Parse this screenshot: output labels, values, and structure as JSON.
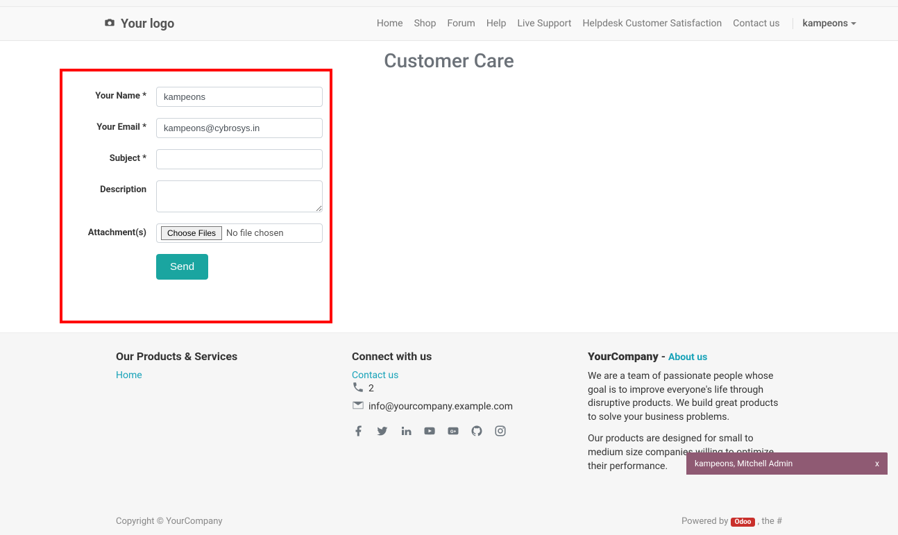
{
  "header": {
    "logo_text": "Your logo",
    "nav": [
      "Home",
      "Shop",
      "Forum",
      "Help",
      "Live Support",
      "Helpdesk Customer Satisfaction",
      "Contact us"
    ],
    "user": "kampeons"
  },
  "page": {
    "title": "Customer Care"
  },
  "form": {
    "name_label": "Your Name *",
    "name_value": "kampeons",
    "email_label": "Your Email *",
    "email_value": "kampeons@cybrosys.in",
    "subject_label": "Subject *",
    "subject_value": "",
    "description_label": "Description",
    "description_value": "",
    "attachment_label": "Attachment(s)",
    "choose_btn": "Choose Files",
    "file_status": "No file chosen",
    "send": "Send"
  },
  "footer": {
    "col1_title": "Our Products & Services",
    "col1_link": "Home",
    "col2_title": "Connect with us",
    "contact_link": "Contact us",
    "phone": "2",
    "email": "info@yourcompany.example.com",
    "company_bold": "YourCompany",
    "about_link": "About us",
    "about_p1": "We are a team of passionate people whose goal is to improve everyone's life through disruptive products. We build great products to solve your business problems.",
    "about_p2": "Our products are designed for small to medium size companies willing to optimize their performance.",
    "copyright": "Copyright © YourCompany",
    "powered_prefix": "Powered by ",
    "odoo": "Odoo",
    "powered_suffix": ", the #"
  },
  "chat": {
    "title": "kampeons, Mitchell Admin",
    "close": "x"
  }
}
